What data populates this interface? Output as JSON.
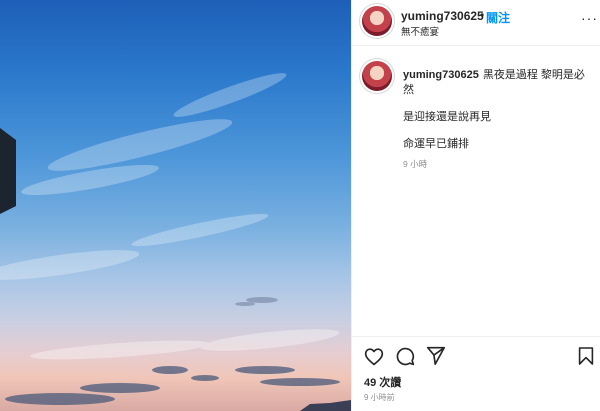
{
  "header": {
    "username": "yuming730625",
    "separator": "•",
    "follow_label": "關注",
    "location": "無不癒宴",
    "more_glyph": "···"
  },
  "caption": {
    "username": "yuming730625",
    "line1": "黑夜是過程 黎明是必然",
    "line2": "是迎接還是說再見",
    "line3": "命運早已鋪排",
    "ago": "9 小時"
  },
  "actions": {
    "icons": [
      "heart-icon",
      "comment-icon",
      "share-icon",
      "bookmark-icon"
    ],
    "likes": "49 次讚",
    "timestamp": "9 小時前"
  },
  "colors": {
    "accent": "#0095f6",
    "text": "#262626",
    "muted": "#8e8e8e",
    "divider": "#efefef"
  }
}
